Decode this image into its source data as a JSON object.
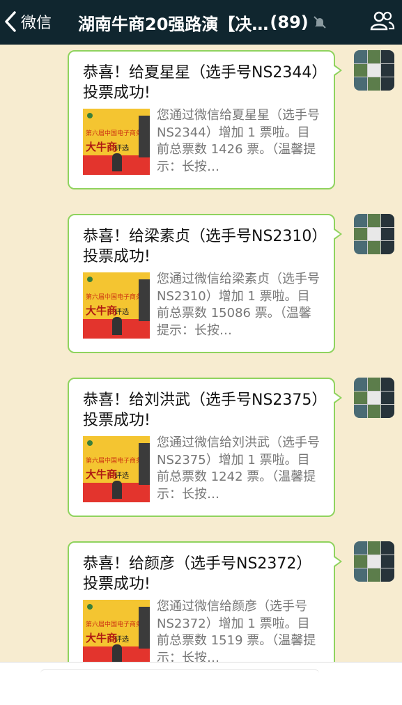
{
  "nav": {
    "back_label": "微信",
    "title": "湖南牛商20强路演【决…",
    "member_count": "(89)"
  },
  "messages": [
    {
      "title": "恭喜！给夏星星（选手号NS2344）投票成功!",
      "desc": "您通过微信给夏星星（选手号NS2344）增加 1 票啦。目前总票数 1426 票。（温馨提示：长按…"
    },
    {
      "title": "恭喜！给梁素贞（选手号NS2310）投票成功!",
      "desc": "您通过微信给梁素贞（选手号NS2310）增加 1 票啦。目前总票数 15086 票。（温馨提示：长按…"
    },
    {
      "title": "恭喜！给刘洪武（选手号NS2375）投票成功!",
      "desc": "您通过微信给刘洪武（选手号NS2375）增加 1 票啦。目前总票数 1242 票。（温馨提示：长按…"
    },
    {
      "title": "恭喜！给颜彦（选手号NS2372）投票成功!",
      "desc": "您通过微信给颜彦（选手号NS2372）增加 1 票啦。目前总票数 1519 票。（温馨提示：长按…"
    }
  ],
  "thumbnail": {
    "line1": "第六届中国电子商务",
    "line2": "大牛商",
    "line3": "评选"
  },
  "colors": {
    "navbar": "#10262f",
    "bubble_border": "#8fd35e",
    "chat_background": "#f7ecd0"
  },
  "icons": {
    "back": "chevron-left-icon",
    "mute": "mute-bell-icon",
    "group": "group-members-icon"
  }
}
